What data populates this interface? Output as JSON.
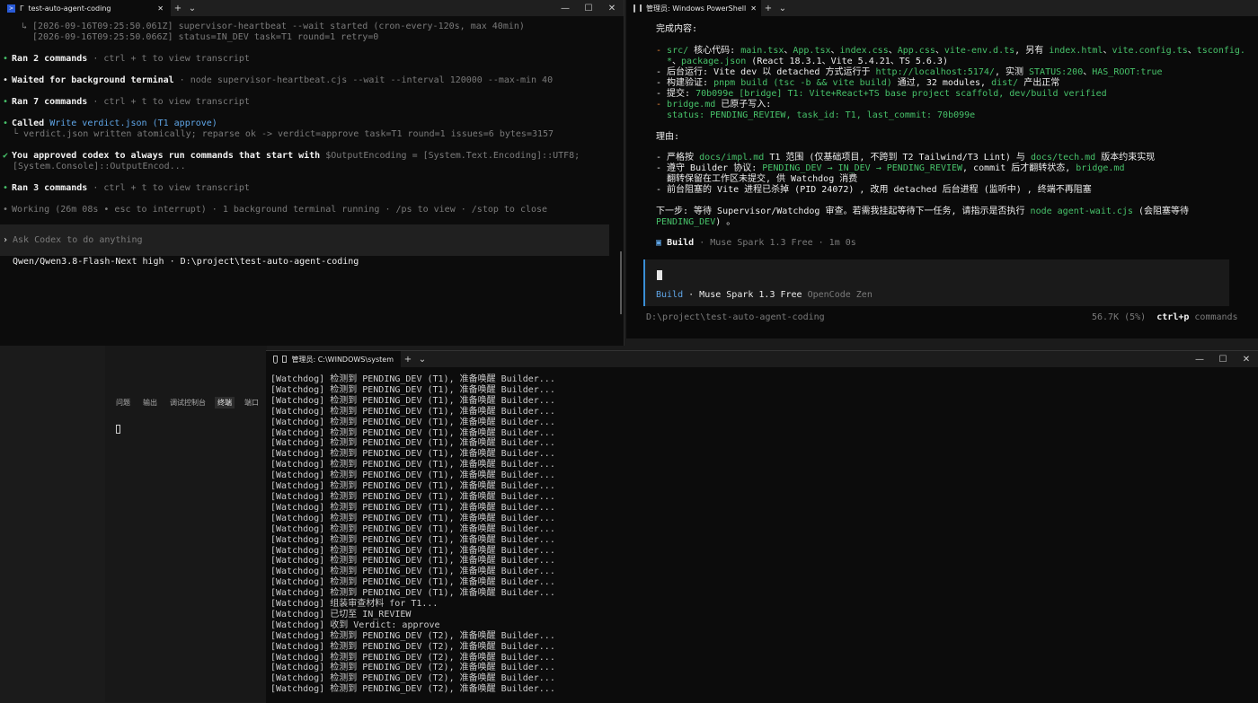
{
  "codex": {
    "tab_title": "test-auto-agent-coding",
    "tab_prefix": "Γ",
    "lines": {
      "l1": "↳ [2026-09-16T09:25:50.061Z] supervisor-heartbeat --wait started (cron-every-120s, max 40min)",
      "l2": "[2026-09-16T09:25:50.066Z] status=IN_DEV task=T1 round=1 retry=0",
      "ran2_head": "Ran 2 commands",
      "ran2_tail": " · ctrl + t to view transcript",
      "waited_head": "Waited for background terminal",
      "waited_tail": " · node supervisor-heartbeat.cjs --wait --interval 120000 --max-min 40",
      "ran7_head": "Ran 7 commands",
      "ran7_tail": " · ctrl + t to view transcript",
      "called_head": "Called ",
      "called_tail": "Write verdict.json (T1 approve)",
      "called_sub": "└ verdict.json written atomically; reparse ok -> verdict=approve task=T1 round=1 issues=6 bytes=3157",
      "approved_a": "You approved codex to always run commands that start with ",
      "approved_b": "$OutputEncoding = [System.Text.Encoding]::UTF8;",
      "approved_c": "[System.Console]::OutputEncod...",
      "ran3_head": "Ran 3 commands",
      "ran3_tail": " · ctrl + t to view transcript",
      "working": "Working (26m 08s • esc to interrupt) · 1 background terminal running · /ps to view · /stop to close"
    },
    "prompt_symbol": "›",
    "input_placeholder": "Ask Codex to do anything",
    "model_info": "Qwen/Qwen3.8-Flash-Next high",
    "path": "· D:\\project\\test-auto-agent-coding"
  },
  "ps": {
    "tab_title": "管理员: Windows PowerShell",
    "done_title": "完成内容:",
    "b1_a": "- ",
    "b1_b": "src/",
    "b1_c": " 核心代码: ",
    "b1_d": "main.tsx",
    "b1_e": "、",
    "b1_f": "App.tsx",
    "b1_g": "、",
    "b1_h": "index.css",
    "b1_i": "、",
    "b1_j": "App.css",
    "b1_k": "、",
    "b1_l": "vite-env.d.ts",
    "b1_m": ", 另有 ",
    "b1_n": "index.html",
    "b1_o": "、",
    "b1_p": "vite.config.ts",
    "b1_q": "、",
    "b1_r": "tsconfig.",
    "b1_s": "*",
    "b1_t": "、",
    "b1_u": "package.json",
    "b1_v": " (React 18.3.1、Vite 5.4.21、TS 5.6.3)",
    "b2_a": "- 后台运行: Vite dev 以 detached 方式运行于 ",
    "b2_b": "http://localhost:5174/",
    "b2_c": ", 实测 ",
    "b2_d": "STATUS:200",
    "b2_e": "、",
    "b2_f": "HAS_ROOT:true",
    "b3_a": "- 构建验证: ",
    "b3_b": "pnpm build (tsc -b && vite build)",
    "b3_c": " 通过, 32 modules, ",
    "b3_d": "dist/",
    "b3_e": " 产出正常",
    "b4_a": "- 提交: ",
    "b4_b": "70b099e [bridge] T1: Vite+React+TS base project scaffold, dev/build verified",
    "b5_a": "- ",
    "b5_b": "bridge.md",
    "b5_c": " 已原子写入:",
    "b5_d": "status: PENDING_REVIEW, task_id: T1, last_commit: 70b099e",
    "reason_title": "理由:",
    "r1_a": "- 严格按 ",
    "r1_b": "docs/impl.md",
    "r1_c": " T1 范围 (仅基础项目, 不跨到 T2 Tailwind/T3 Lint) 与 ",
    "r1_d": "docs/tech.md",
    "r1_e": " 版本约束实现",
    "r2_a": "- 遵守 Builder 协议: ",
    "r2_b": "PENDING_DEV → IN_DEV → PENDING_REVIEW",
    "r2_c": ", commit 后才翻转状态, ",
    "r2_d": "bridge.md",
    "r2_e": "翻转保留在工作区未提交, 供 Watchdog 消费",
    "r3": "- 前台阻塞的 Vite 进程已杀掉 (PID 24072) , 改用 detached 后台进程 (监听中) , 终端不再阻塞",
    "next_a": "下一步: 等待 Supervisor/Watchdog 审查。若需我挂起等待下一任务, 请指示是否执行 ",
    "next_b": "node agent-wait.cjs",
    "next_c": " (会阻塞等待",
    "next_d": "PENDING_DEV",
    "next_e": ") 。",
    "build_sym": "▣",
    "build_label": "Build",
    "build_meta": " · Muse Spark 1.3 Free · 1m 0s",
    "mode": "Build",
    "mode_model": " · Muse Spark 1.3 Free ",
    "mode_provider": "OpenCode Zen",
    "path": "D:\\project\\test-auto-agent-coding",
    "tokens": "56.7K (5%)",
    "shortcut": "ctrl+p",
    "shortcut_label": " commands"
  },
  "vscode": {
    "tabs": [
      "问题",
      "输出",
      "调试控制台",
      "终端",
      "端口"
    ],
    "active_tab": "终端"
  },
  "cmd": {
    "tab_title": "管理员: C:\\WINDOWS\\system",
    "lines": [
      "[Watchdog] 检测到 PENDING_DEV (T1), 准备唤醒 Builder...",
      "[Watchdog] 检测到 PENDING_DEV (T1), 准备唤醒 Builder...",
      "[Watchdog] 检测到 PENDING_DEV (T1), 准备唤醒 Builder...",
      "[Watchdog] 检测到 PENDING_DEV (T1), 准备唤醒 Builder...",
      "[Watchdog] 检测到 PENDING_DEV (T1), 准备唤醒 Builder...",
      "[Watchdog] 检测到 PENDING_DEV (T1), 准备唤醒 Builder...",
      "[Watchdog] 检测到 PENDING_DEV (T1), 准备唤醒 Builder...",
      "[Watchdog] 检测到 PENDING_DEV (T1), 准备唤醒 Builder...",
      "[Watchdog] 检测到 PENDING_DEV (T1), 准备唤醒 Builder...",
      "[Watchdog] 检测到 PENDING_DEV (T1), 准备唤醒 Builder...",
      "[Watchdog] 检测到 PENDING_DEV (T1), 准备唤醒 Builder...",
      "[Watchdog] 检测到 PENDING_DEV (T1), 准备唤醒 Builder...",
      "[Watchdog] 检测到 PENDING_DEV (T1), 准备唤醒 Builder...",
      "[Watchdog] 检测到 PENDING_DEV (T1), 准备唤醒 Builder...",
      "[Watchdog] 检测到 PENDING_DEV (T1), 准备唤醒 Builder...",
      "[Watchdog] 检测到 PENDING_DEV (T1), 准备唤醒 Builder...",
      "[Watchdog] 检测到 PENDING_DEV (T1), 准备唤醒 Builder...",
      "[Watchdog] 检测到 PENDING_DEV (T1), 准备唤醒 Builder...",
      "[Watchdog] 检测到 PENDING_DEV (T1), 准备唤醒 Builder...",
      "[Watchdog] 检测到 PENDING_DEV (T1), 准备唤醒 Builder...",
      "[Watchdog] 检测到 PENDING_DEV (T1), 准备唤醒 Builder...",
      "[Watchdog] 组装审查材料 for T1...",
      "[Watchdog] 已切至 IN_REVIEW",
      "[Watchdog] 收到 Verdict: approve",
      "[Watchdog] 检测到 PENDING_DEV (T2), 准备唤醒 Builder...",
      "[Watchdog] 检测到 PENDING_DEV (T2), 准备唤醒 Builder...",
      "[Watchdog] 检测到 PENDING_DEV (T2), 准备唤醒 Builder...",
      "[Watchdog] 检测到 PENDING_DEV (T2), 准备唤醒 Builder...",
      "[Watchdog] 检测到 PENDING_DEV (T2), 准备唤醒 Builder...",
      "[Watchdog] 检测到 PENDING_DEV (T2), 准备唤醒 Builder..."
    ]
  },
  "icons": {
    "tab_add": "+",
    "tab_dropdown": "⌄",
    "minimize": "—",
    "maximize": "☐",
    "close": "✕"
  }
}
